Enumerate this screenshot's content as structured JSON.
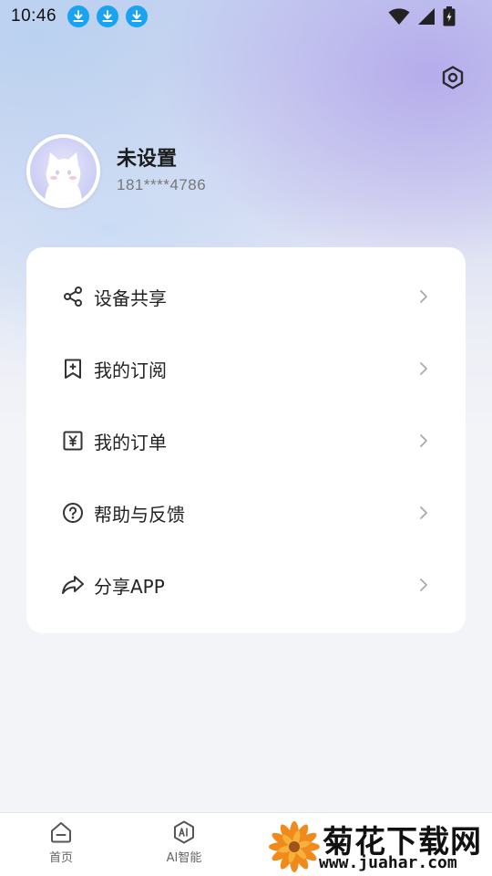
{
  "status_bar": {
    "time": "10:46",
    "download_icons": [
      "download-icon",
      "download-icon",
      "download-icon"
    ],
    "accent": "#1aa3f2"
  },
  "header": {
    "settings_icon": "settings-icon"
  },
  "profile": {
    "name": "未设置",
    "phone": "181****4786",
    "avatar_icon": "cat-avatar"
  },
  "menu": {
    "items": [
      {
        "label": "设备共享",
        "icon": "share-nodes-icon"
      },
      {
        "label": "我的订阅",
        "icon": "bookmark-add-icon"
      },
      {
        "label": "我的订单",
        "icon": "order-yen-icon"
      },
      {
        "label": "帮助与反馈",
        "icon": "help-circle-icon"
      },
      {
        "label": "分享APP",
        "icon": "share-forward-icon"
      }
    ]
  },
  "tabbar": {
    "tabs": [
      {
        "label": "首页",
        "icon": "home-icon"
      },
      {
        "label": "AI智能",
        "icon": "ai-icon"
      }
    ]
  },
  "watermark": {
    "title": "菊花下载网",
    "url": "www.juahar.com",
    "logo": "chrysanthemum-logo"
  }
}
